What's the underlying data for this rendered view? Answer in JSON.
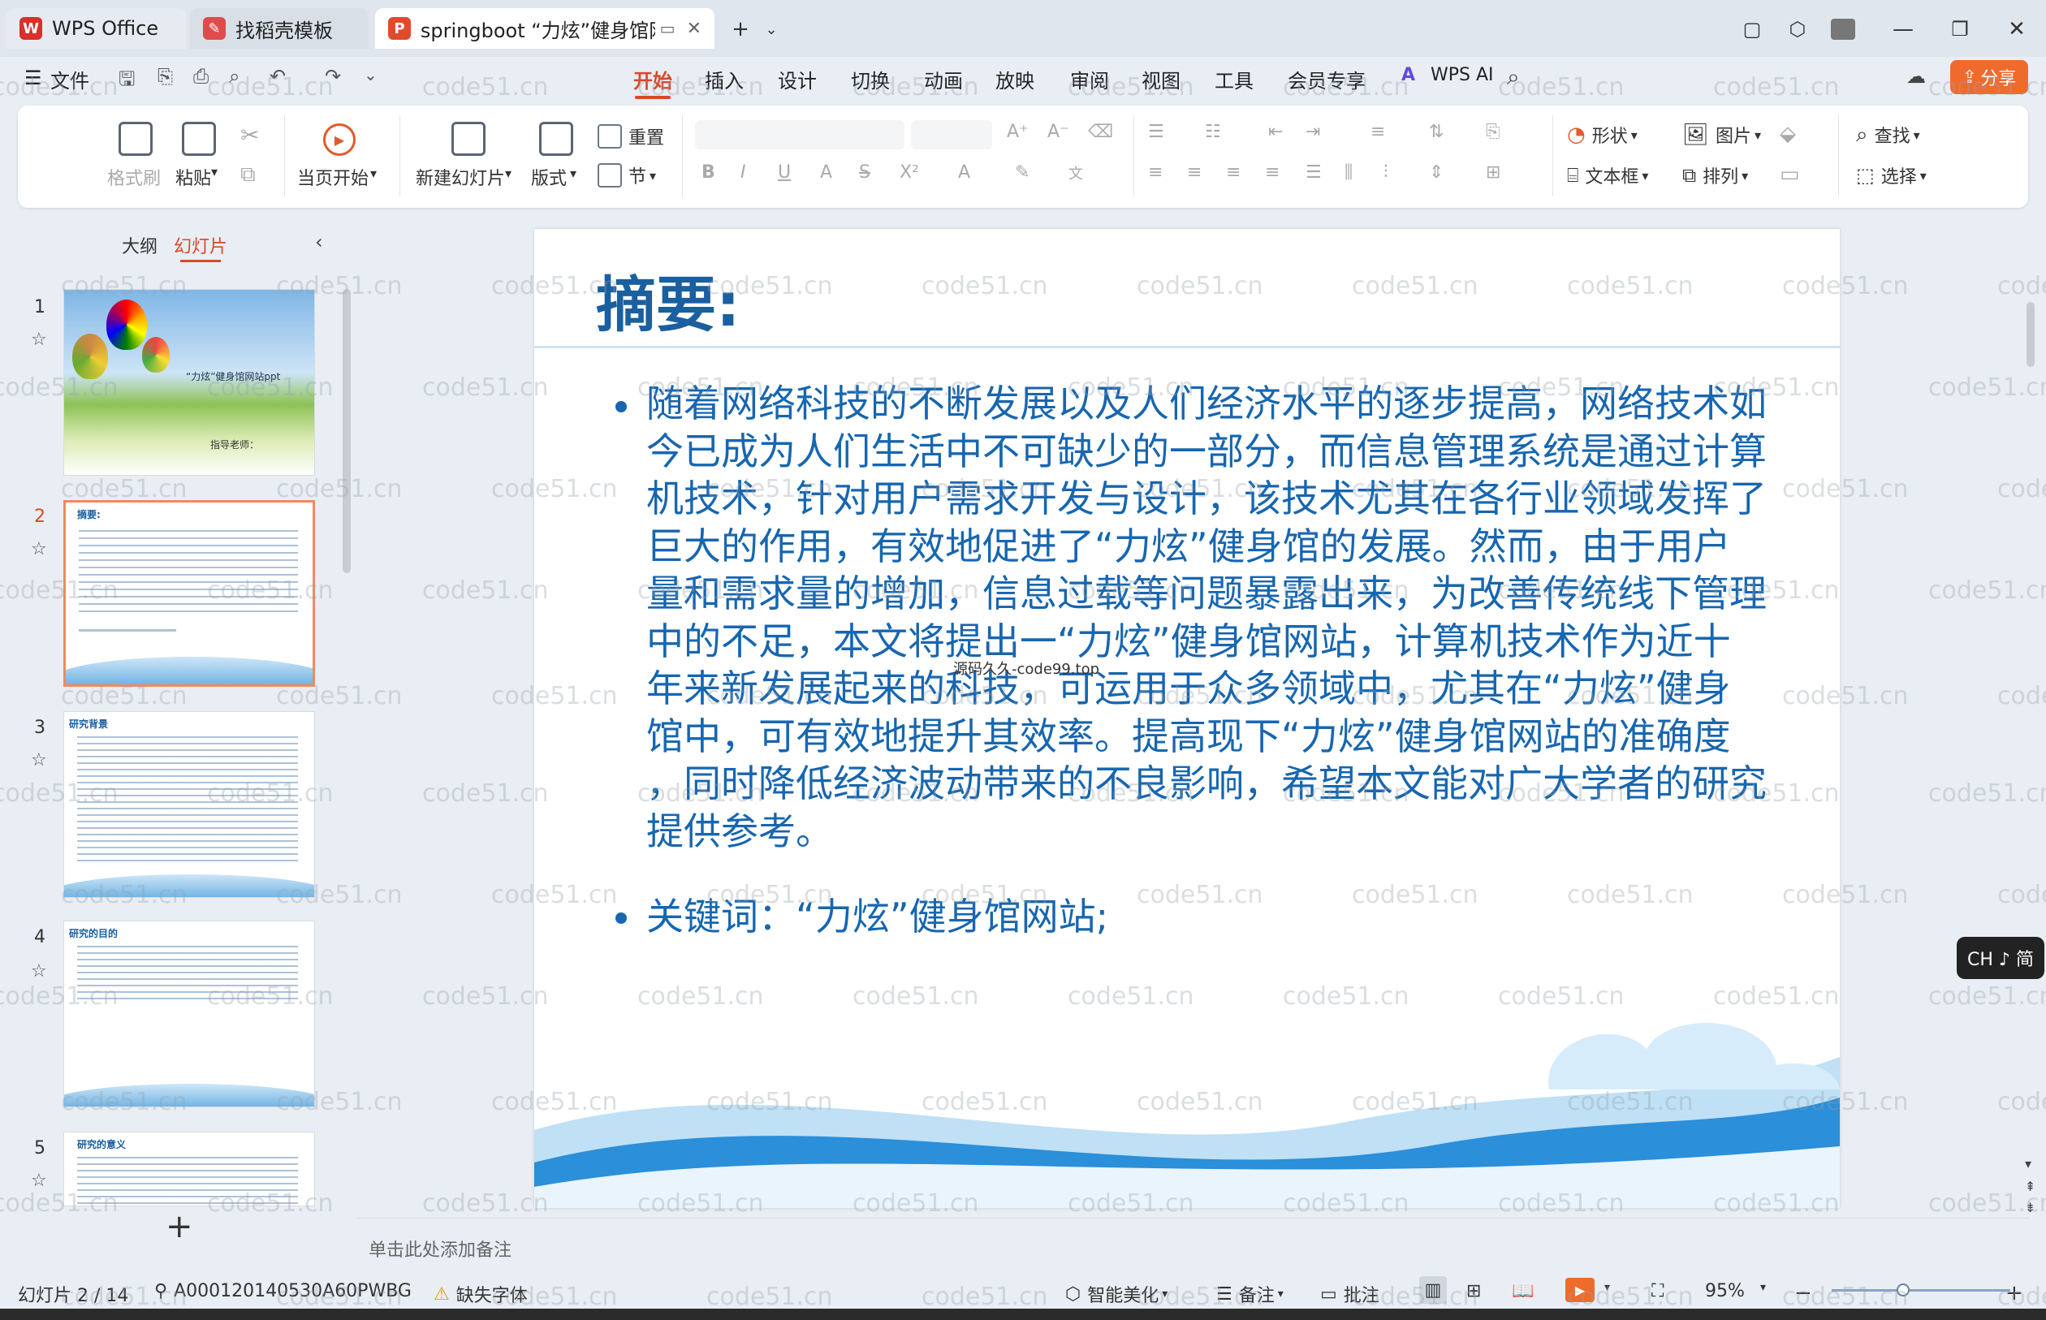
{
  "titlebar": {
    "tabs": [
      {
        "label": "WPS Office",
        "color": "#d9302b"
      },
      {
        "label": "找稻壳模板",
        "color": "#e04b4b"
      },
      {
        "label": "springboot “力炫”健身馆网",
        "color": "#e04b2b"
      }
    ]
  },
  "menu": {
    "file": "文件",
    "items": [
      "开始",
      "插入",
      "设计",
      "切换",
      "动画",
      "放映",
      "审阅",
      "视图",
      "工具",
      "会员专享"
    ],
    "active": "开始",
    "wps_ai": "WPS AI",
    "share": "分享"
  },
  "ribbon": {
    "format_painter": "格式刷",
    "paste": "粘贴",
    "from_current": "当页开始",
    "new_slide": "新建幻灯片",
    "layout": "版式",
    "reset": "重置",
    "section": "节",
    "shape": "形状",
    "picture": "图片",
    "textbox": "文本框",
    "arrange": "排列",
    "find": "查找",
    "select": "选择"
  },
  "leftpanel": {
    "tab_outline": "大纲",
    "tab_slides": "幻灯片",
    "slides": [
      {
        "num": "1",
        "title": "“力炫”健身馆网站ppt",
        "sub": "指导老师："
      },
      {
        "num": "2",
        "title": "摘要:"
      },
      {
        "num": "3",
        "title": "研究背景"
      },
      {
        "num": "4",
        "title": "研究的目的"
      },
      {
        "num": "5",
        "title": "研究的意义"
      }
    ],
    "add": "+"
  },
  "slide": {
    "title": "摘要:",
    "bullet1_lines": [
      "随着网络科技的不断发展以及人们经济水平的逐步提高，网络技术如",
      "今已成为人们生活中不可缺少的一部分，而信息管理系统是通过计算",
      "机技术，针对用户需求开发与设计，该技术尤其在各行业领域发挥了",
      "巨大的作用，有效地促进了“力炫”健身馆的发展。然而，由于用户",
      "量和需求量的增加，信息过载等问题暴露出来，为改善传统线下管理",
      "中的不足，本文将提出一“力炫”健身馆网站，计算机技术作为近十",
      "年来新发展起来的科技，可运用于众多领域中，尤其在“力炫”健身",
      "馆中，可有效地提升其效率。提高现下“力炫”健身馆网站的准确度",
      "，同时降低经济波动带来的不良影响，希望本文能对广大学者的研究",
      "提供参考。"
    ],
    "bullet2": "关键词：“力炫”健身馆网站;",
    "overlay_text": "源码久久-code99.top"
  },
  "notes": {
    "placeholder": "单击此处添加备注"
  },
  "statusbar": {
    "slide_count": "幻灯片 2 / 14",
    "doc_id": "A000120140530A60PWBG",
    "missing_font": "缺失字体",
    "smart_beautify": "智能美化",
    "notes": "备注",
    "comment": "批注",
    "zoom": "95%"
  },
  "ime": {
    "label": "CH ♪ 简"
  },
  "watermark": "code51.cn",
  "colors": {
    "accent": "#d9492b",
    "slide_text": "#1766b0",
    "share_btn": "#f06a2c"
  }
}
